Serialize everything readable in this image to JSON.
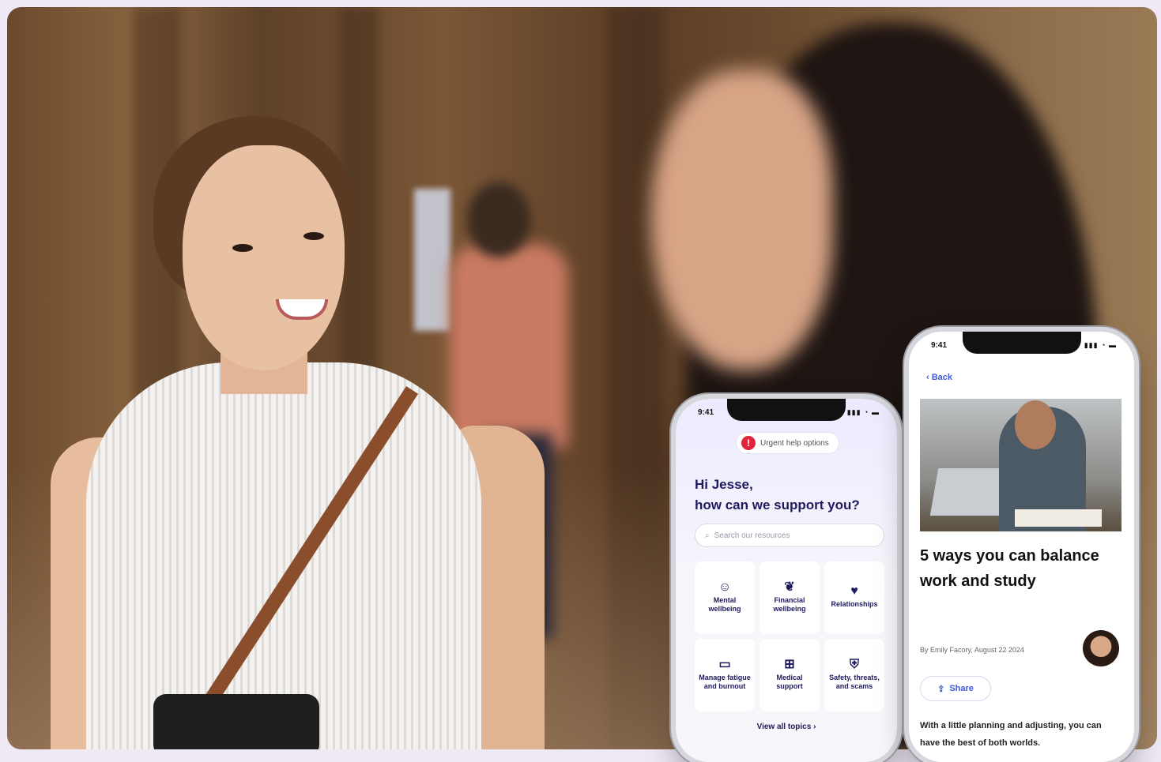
{
  "phone_left": {
    "status_time": "9:41",
    "status_icons": "▮▮▮ ◔ ▬",
    "urgent_label": "Urgent help options",
    "greeting_line1": "Hi Jesse,",
    "greeting_line2": "how can we support you?",
    "search_placeholder": "Search our resources",
    "tiles": [
      {
        "icon": "head-icon",
        "glyph": "☺",
        "label": "Mental wellbeing"
      },
      {
        "icon": "plant-icon",
        "glyph": "❦",
        "label": "Financial wellbeing"
      },
      {
        "icon": "hearts-icon",
        "glyph": "♥",
        "label": "Relationships"
      },
      {
        "icon": "battery-icon",
        "glyph": "▭",
        "label": "Manage fatigue and burnout"
      },
      {
        "icon": "medical-icon",
        "glyph": "⊞",
        "label": "Medical support"
      },
      {
        "icon": "shield-icon",
        "glyph": "⛨",
        "label": "Safety, threats, and scams"
      }
    ],
    "view_all": "View all topics  ›"
  },
  "phone_right": {
    "status_time": "9:41",
    "status_icons": "▮▮▮ ◔ ▬",
    "back_label": "‹ Back",
    "article_title": "5 ways you can balance work and study",
    "byline": "By Emily Facory, August 22 2024",
    "share_label": "Share",
    "intro_text": "With a little planning and adjusting, you can have the best of both worlds."
  },
  "colors": {
    "brand_navy": "#1e1a5e",
    "link_blue": "#3d5bd9",
    "urgent_red": "#e0243c"
  }
}
